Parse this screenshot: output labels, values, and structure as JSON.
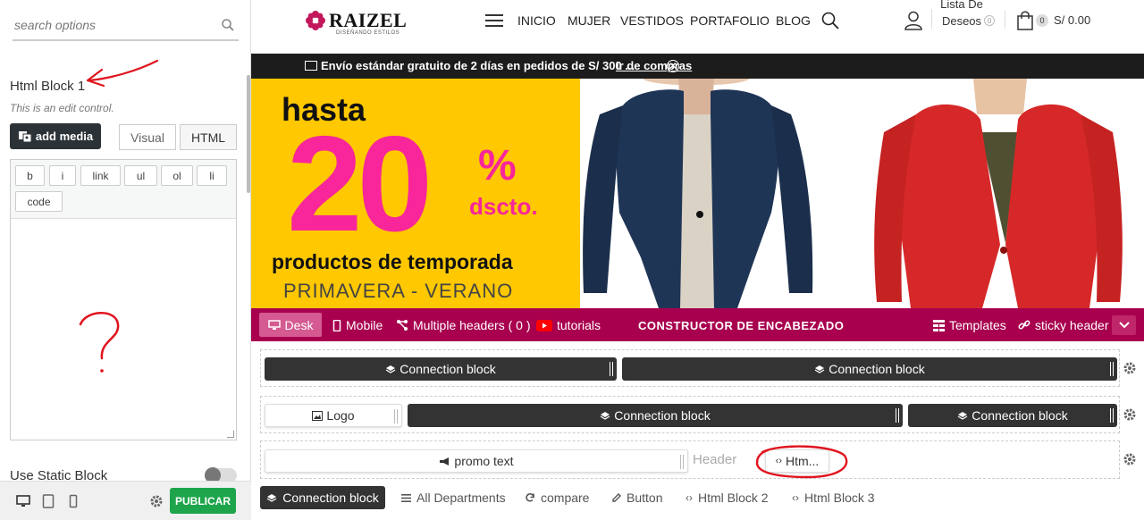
{
  "panel": {
    "search_placeholder": "search options",
    "control_title": "Html Block 1",
    "control_description": "This is an edit control.",
    "add_media_label": "add media",
    "tab_visual": "Visual",
    "tab_html": "HTML",
    "quicktags": [
      "b",
      "i",
      "link",
      "ul",
      "ol",
      "li",
      "code"
    ],
    "static_block_label": "Use Static Block",
    "publish_label": "PUBLICAR",
    "annotation_question": "?"
  },
  "site": {
    "logo_text": "RAIZEL",
    "logo_tagline": "DISEÑANDO ESTILOS",
    "nav": [
      "INICIO",
      "MUJER",
      "VESTIDOS",
      "PORTAFOLIO",
      "BLOG"
    ],
    "wishlist": "Lista De Deseos",
    "wishlist_count": "0",
    "cart_count": "0",
    "cart_total": "S/ 0.00",
    "promo_text": "Envío estándar gratuito de 2 días en pedidos de S/ 300 ...",
    "promo_link": "Ir de compras",
    "banner": {
      "hasta": "hasta",
      "number": "20",
      "percent": "%",
      "dscto": "dscto.",
      "products": "productos de temporada",
      "season": "PRIMAVERA - VERANO"
    }
  },
  "builder": {
    "desk": "Desk",
    "mobile": "Mobile",
    "multiple_headers": "Multiple headers ( 0 )",
    "tutorials": "tutorials",
    "title": "CONSTRUCTOR DE ENCABEZADO",
    "templates": "Templates",
    "sticky_header": "sticky header",
    "row1": [
      "Connection block",
      "Connection block"
    ],
    "row2": [
      "Logo",
      "Connection block",
      "Connection block"
    ],
    "row3": [
      "promo text",
      "Header",
      "Htm..."
    ],
    "available": [
      "Connection block",
      "All Departments",
      "compare",
      "Button",
      "Html Block 2",
      "Html Block 3"
    ]
  },
  "colors": {
    "accent": "#a8004e",
    "publish": "#1ea54c",
    "banner_yellow": "#ffc800",
    "banner_pink": "#f8269a",
    "annotation_red": "#e0141e"
  }
}
